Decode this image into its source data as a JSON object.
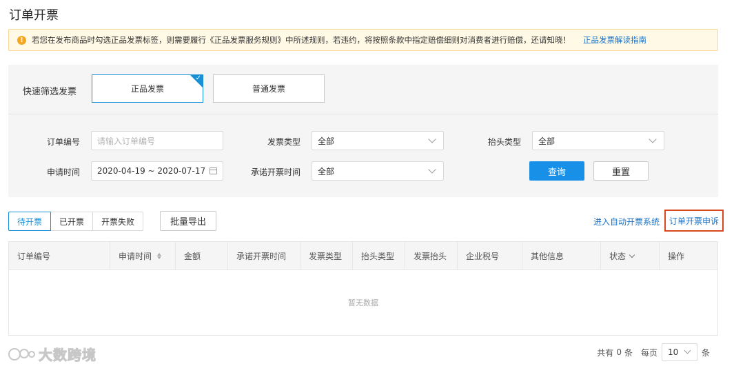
{
  "page": {
    "title": "订单开票"
  },
  "notice": {
    "text": "若您在发布商品时勾选正品发票标签，则需要履行《正品发票服务规则》中所述规则，若违约，将按照条款中指定赔偿细则对消费者进行赔偿，还请知晓！",
    "link": "正品发票解读指南",
    "icon": "warning-icon"
  },
  "quick_filter": {
    "label": "快速筛选发票",
    "options": [
      "正品发票",
      "普通发票"
    ],
    "selected": "正品发票"
  },
  "form": {
    "order_no": {
      "label": "订单编号",
      "placeholder": "请输入订单编号"
    },
    "invoice_type": {
      "label": "发票类型",
      "value": "全部"
    },
    "title_type": {
      "label": "抬头类型",
      "value": "全部"
    },
    "apply_time": {
      "label": "申请时间",
      "value": "2020-04-19 ~ 2020-07-17"
    },
    "promise_time": {
      "label": "承诺开票时间",
      "value": "全部"
    },
    "query_label": "查询",
    "reset_label": "重置"
  },
  "toolbar": {
    "tabs": [
      "待开票",
      "已开票",
      "开票失败"
    ],
    "active_tab": "待开票",
    "export_label": "批量导出",
    "auto_link": "进入自动开票系统",
    "appeal_label": "订单开票申诉"
  },
  "table": {
    "columns": [
      "订单编号",
      "申请时间",
      "金额",
      "承诺开票时间",
      "发票类型",
      "抬头类型",
      "发票抬头",
      "企业税号",
      "其他信息",
      "状态",
      "操作"
    ],
    "empty_text": "暂无数据"
  },
  "pagination": {
    "total_prefix": "共有",
    "total": "0",
    "total_suffix": "条",
    "per_page_label": "每页",
    "per_page": "10",
    "per_page_suffix": "条"
  },
  "watermark": {
    "text": "大数跨境"
  },
  "colors": {
    "primary": "#1890e8",
    "alert_bg": "#fff9e6",
    "alert_icon": "#f5a623",
    "highlight_border": "#d6471c",
    "link": "#1a73c6"
  }
}
